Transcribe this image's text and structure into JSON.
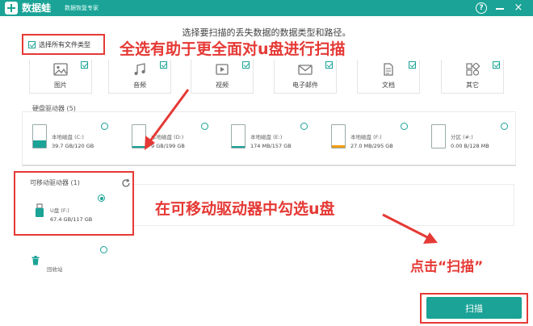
{
  "app": {
    "name": "数据蛙",
    "subtitle": "数据恢复专家",
    "help_glyph": "?",
    "close_glyph": "×"
  },
  "prompt": "选择要扫描的丢失数据的数据类型和路径。",
  "select_all": {
    "label": "选择所有文件类型",
    "checked": true
  },
  "file_types": [
    {
      "label": "图片",
      "checked": true,
      "icon": "image-icon"
    },
    {
      "label": "音频",
      "checked": true,
      "icon": "audio-icon"
    },
    {
      "label": "视频",
      "checked": true,
      "icon": "video-icon"
    },
    {
      "label": "电子邮件",
      "checked": true,
      "icon": "email-icon"
    },
    {
      "label": "文档",
      "checked": true,
      "icon": "document-icon"
    },
    {
      "label": "其它",
      "checked": true,
      "icon": "other-icon"
    }
  ],
  "hard_drives": {
    "label": "硬盘驱动器 (5)",
    "items": [
      {
        "name": "本地磁盘 (C:)",
        "size": "39.7 GB/120 GB",
        "used": 0.33,
        "color": "#1aa396"
      },
      {
        "name": "本地磁盘 (D:)",
        "size": "9 GB/199 GB",
        "used": 0.05,
        "color": "#1aa396"
      },
      {
        "name": "本地磁盘 (E:)",
        "size": "174 MB/157 GB",
        "used": 0.01,
        "color": "#1aa396"
      },
      {
        "name": "本地磁盘 (F:)",
        "size": "27.0 MB/295 GB",
        "used": 0.1,
        "color": "#f39c12"
      },
      {
        "name": "分区 (#:)",
        "size": "0.00 B/128 MB",
        "used": 0.0,
        "color": "#f1c40f"
      }
    ]
  },
  "removable": {
    "label": "可移动驱动器 (1)",
    "items": [
      {
        "name": "U盘 (F:)",
        "size": "67.4 GB/117 GB",
        "selected": true
      }
    ]
  },
  "recycle_bin": {
    "label": "回收站"
  },
  "annotations": {
    "select_all": "全选有助于更全面对u盘进行扫描",
    "removable": "在可移动驱动器中勾选u盘",
    "scan": "点击“扫描”"
  },
  "scan_button": {
    "label": "扫描"
  },
  "colors": {
    "accent": "#1aa396",
    "annotation": "#e53935"
  }
}
